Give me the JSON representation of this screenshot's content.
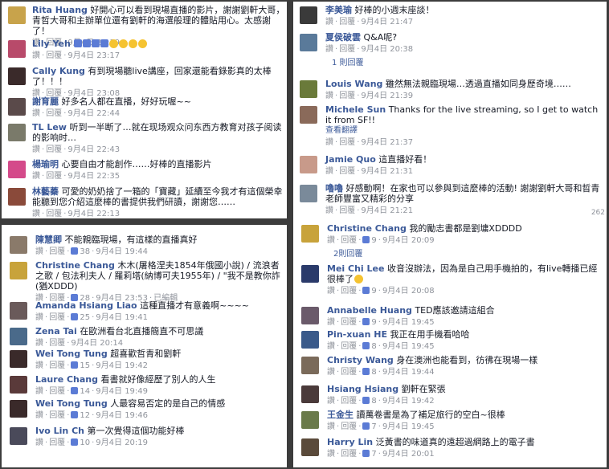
{
  "labels": {
    "like": "讚",
    "reply": "回覆",
    "edited": "已編輯",
    "see_translation": "查看翻譯"
  },
  "panel1": [
    {
      "name": "Rita Huang",
      "text": "好開心可以看到現場直播的影片，謝謝劉軒大哥，青哲大哥和主辦單位還有劉軒的海選般理的體貼用心。太感謝了！",
      "date": "9月4日 23:19",
      "avatar": "#c8a34b"
    },
    {
      "name": "Lily Yeh",
      "text": "",
      "date": "9月4日 23:17",
      "avatar": "#b84a6a",
      "emoji": true
    },
    {
      "name": "Cally Kung",
      "text": "有到現場聽live講座，回家還能看錄影真的太棒了！！！",
      "date": "9月4日 23:08",
      "avatar": "#3a2a2a"
    },
    {
      "name": "謝育麗",
      "text": "好多名人都在直播，好好玩喔~~",
      "date": "9月4日 22:44",
      "avatar": "#5a4a4a"
    },
    {
      "name": "TL Lew",
      "text": "听到一半断了…就在现场观众问东西方教育对孩子阅读的影响时…",
      "date": "9月4日 22:43",
      "avatar": "#7a7a6a"
    },
    {
      "name": "楊瑜明",
      "text": "心要自由才能創作……好棒的直播影片",
      "date": "9月4日 22:35",
      "avatar": "#d44a8a"
    },
    {
      "name": "林藝蓁",
      "text": "可愛的奶奶捨了一箱的「寶藏」延續至今我才有這個榮幸能聽到您介紹這麼棒的書提供我們研讀，謝謝您……",
      "date": "9月4日 22:13",
      "avatar": "#8a4a3a"
    }
  ],
  "panel2": [
    {
      "name": "李美瑜",
      "text": "好棒的小週末座談！",
      "date": "9月4日 21:47",
      "avatar": "#3a3a3a"
    },
    {
      "name": "夏侯破雲",
      "text": "Q&A呢?",
      "date": "9月4日 20:38",
      "avatar": "#5a7a9a",
      "replies": "1 則回覆"
    },
    {
      "name": "Louis Wang",
      "text": "雖然無法親臨現場…透過直播如同身歷奇境……",
      "date": "9月4日 21:39",
      "avatar": "#6a7a3a"
    },
    {
      "name": "Michele Sun",
      "text": "Thanks for the live streaming, so I get to watch it from SF!!",
      "date": "9月4日 21:37",
      "avatar": "#8a6a5a",
      "translate": true
    },
    {
      "name": "Jamie Quo",
      "text": "這直播好看！",
      "date": "9月4日 21:31",
      "avatar": "#c89a8a"
    },
    {
      "name": "嚕嚕",
      "text": "好感動啊！在家也可以參與到這麼棒的活動! 謝謝劉軒大哥和晢青老師豐富又精彩的分享",
      "date": "9月4日 21:21",
      "avatar": "#7a8a9a"
    }
  ],
  "panel3": [
    {
      "name": "陳慧卿",
      "text": "不能親臨現場，有這樣的直播真好",
      "date": "9月4日 19:44",
      "likes": "38",
      "avatar": "#8a7a6a"
    },
    {
      "name": "Christine Chang",
      "text": "木木(屠格涅夫1854年俄國小說) / 流浪者之歌 / 包法利夫人 / 羅莉塔(納博可夫1955年) / \"我不是教你詐(猶XDDD)",
      "date": "9月4日 23:53",
      "likes": "28",
      "avatar": "#c8a33b",
      "edited": true
    },
    {
      "name": "Amanda Hsiang Liao",
      "text": "這種直播才有意義啊~~~~",
      "date": "9月4日 19:41",
      "likes": "25",
      "avatar": "#6a5a5a"
    },
    {
      "name": "Zena Tai",
      "text": "在歐洲看台北直播簡直不可思議",
      "date": "9月4日 20:14",
      "likes": "",
      "avatar": "#4a6a8a"
    },
    {
      "name": "Wei Tong Tung",
      "text": "超喜歡哲青和劉軒",
      "date": "9月4日 19:42",
      "likes": "15",
      "avatar": "#3a2a2a"
    },
    {
      "name": "Laure Chang",
      "text": "看書就好像經歷了別人的人生",
      "date": "9月4日 19:49",
      "likes": "14",
      "avatar": "#5a3a3a"
    },
    {
      "name": "Wei Tong Tung",
      "text": "人最容易否定的是自己的情感",
      "date": "9月4日 19:46",
      "likes": "12",
      "avatar": "#3a2a2a"
    },
    {
      "name": "Ivo Lin Ch",
      "text": "第一次覺得這個功能好棒",
      "date": "9月4日 20:19",
      "likes": "10",
      "avatar": "#4a4a5a"
    }
  ],
  "panel4": [
    {
      "name": "Christine Chang",
      "text": "我的勵志書都是劉墉XDDDD",
      "date": "9月4日 20:09",
      "likes": "9",
      "avatar": "#c8a33b",
      "replies": "2則回覆"
    },
    {
      "name": "Mei Chi Lee",
      "text": "收音沒辦法，因為是自己用手機拍的，有live轉播已經很棒了",
      "date": "9月4日 20:08",
      "likes": "9",
      "avatar": "#2a3a6a",
      "emoji": true
    },
    {
      "name": "Annabelle Huang",
      "text": "TED應該邀請這組合",
      "date": "9月4日 19:45",
      "likes": "9",
      "avatar": "#6a5a6a"
    },
    {
      "name": "Pin-xuan HE",
      "text": "我正在用手機看哈哈",
      "date": "9月4日 19:45",
      "likes": "8",
      "avatar": "#3a5a8a"
    },
    {
      "name": "Christy Wang",
      "text": "身在澳洲也能看到，彷彿在現場一樣",
      "date": "9月4日 19:44",
      "likes": "8",
      "avatar": "#7a6a5a"
    },
    {
      "name": "Hsiang Hsiang",
      "text": "劉軒在緊張",
      "date": "9月4日 19:42",
      "likes": "8",
      "avatar": "#4a3a3a"
    },
    {
      "name": "王金生",
      "text": "讀萬卷書是為了補足旅行的空白~很棒",
      "date": "9月4日 19:45",
      "likes": "7",
      "avatar": "#6a7a4a"
    },
    {
      "name": "Harry Lin",
      "text": "泛黃書的味道真的遠超過網路上的電子書",
      "date": "9月4日 20:01",
      "likes": "7",
      "avatar": "#5a4a3a"
    }
  ],
  "panel2_tag": "262"
}
